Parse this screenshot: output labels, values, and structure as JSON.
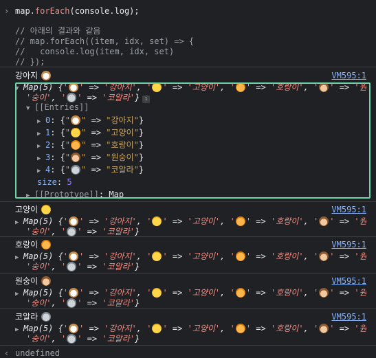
{
  "input": {
    "prompt": "›",
    "obj": "map.",
    "method": "forEach",
    "args": "(console.log);"
  },
  "comments": [
    "// 아래의 결과와 같음",
    "// map.forEach((item, idx, set) => {",
    "//   console.log(item, idx, set)",
    "// });"
  ],
  "source_link": "VM595:1",
  "entries": [
    {
      "label": "강아지",
      "emoji": "dog-face-emoji",
      "key_emoji": "dog",
      "value": "강아지",
      "index": "0"
    },
    {
      "label": "고양이",
      "emoji": "cat-face-emoji",
      "key_emoji": "cat",
      "value": "고양이",
      "index": "1"
    },
    {
      "label": "호랑이",
      "emoji": "tiger-face-emoji",
      "key_emoji": "tiger",
      "value": "호랑이",
      "index": "2"
    },
    {
      "label": "원숭이",
      "emoji": "monkey-face-emoji",
      "key_emoji": "monkey",
      "value": "원숭이",
      "index": "3"
    },
    {
      "label": "코알라",
      "emoji": "koala-face-emoji",
      "key_emoji": "koala",
      "value": "코알라",
      "index": "4"
    }
  ],
  "map_summary": {
    "prefix": "Map(5) {",
    "arrow": " => ",
    "open": "{",
    "close": "}"
  },
  "expanded": {
    "entries_label": "[[Entries]]",
    "size_key": "size",
    "size_value": "5",
    "prototype_key": "[[Prototype]]",
    "prototype_value": "Map"
  },
  "info_badge": "i",
  "result": {
    "chevron": "‹",
    "text": "undefined"
  },
  "colors": {
    "background": "#202124",
    "highlight_border": "#6ad5a9",
    "link": "#8ab4f8",
    "string": "#f28b82"
  }
}
